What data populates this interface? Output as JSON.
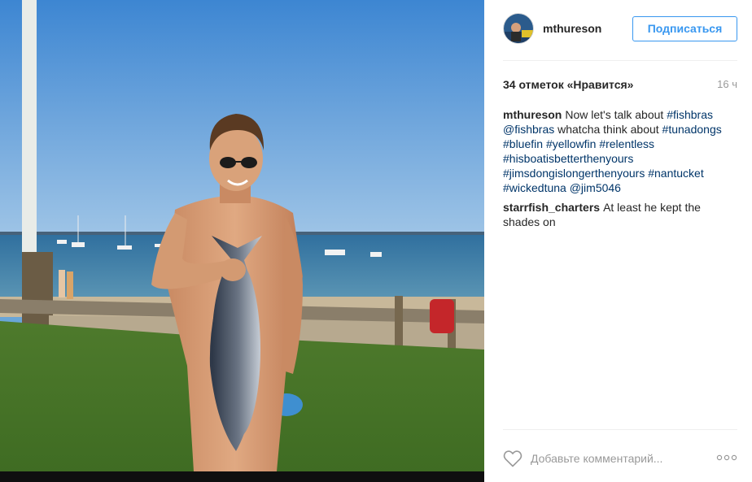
{
  "post": {
    "author": {
      "username": "mthureson",
      "follow_label": "Подписаться"
    },
    "likes_text": "34 отметок «Нравится»",
    "time_text": "16 ч",
    "caption": {
      "username": "mthureson",
      "parts": [
        {
          "type": "text",
          "text": "Now let's talk about "
        },
        {
          "type": "tag",
          "text": "#fishbras"
        },
        {
          "type": "text",
          "text": " "
        },
        {
          "type": "tag",
          "text": "@fishbras"
        },
        {
          "type": "text",
          "text": " whatcha think about "
        },
        {
          "type": "tag",
          "text": "#tunadongs"
        },
        {
          "type": "text",
          "text": " "
        },
        {
          "type": "tag",
          "text": "#bluefin"
        },
        {
          "type": "text",
          "text": " "
        },
        {
          "type": "tag",
          "text": "#yellowfin"
        },
        {
          "type": "text",
          "text": " "
        },
        {
          "type": "tag",
          "text": "#relentless"
        },
        {
          "type": "text",
          "text": " "
        },
        {
          "type": "tag",
          "text": "#hisboatisbetterthenyours"
        },
        {
          "type": "text",
          "text": " "
        },
        {
          "type": "tag",
          "text": "#jimsdongislongerthenyours"
        },
        {
          "type": "text",
          "text": " "
        },
        {
          "type": "tag",
          "text": "#nantucket"
        },
        {
          "type": "text",
          "text": " "
        },
        {
          "type": "tag",
          "text": "#wickedtuna"
        },
        {
          "type": "text",
          "text": " "
        },
        {
          "type": "tag",
          "text": "@jim5046"
        }
      ]
    },
    "comments": [
      {
        "username": "starrfish_charters",
        "text": "At least he kept the shades on"
      }
    ],
    "comment_placeholder": "Добавьте комментарий...",
    "icons": {
      "like": "heart-outline-icon",
      "more": "more-options-icon"
    },
    "colors": {
      "accent": "#3897f0",
      "hashtag": "#003569",
      "muted": "#999999",
      "divider": "#efefef"
    }
  }
}
